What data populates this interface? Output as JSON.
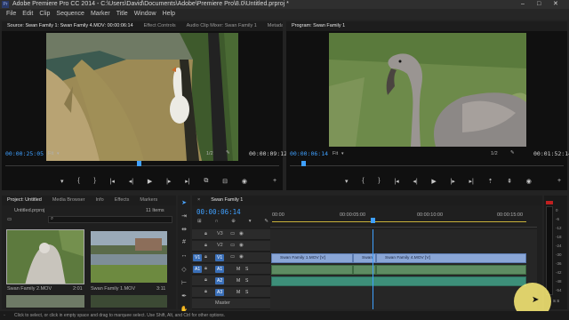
{
  "window": {
    "title": "Adobe Premiere Pro CC 2014 - C:\\Users\\David\\Documents\\Adobe\\Premiere Pro\\8.0\\Untitled.prproj *"
  },
  "menu": [
    "File",
    "Edit",
    "Clip",
    "Sequence",
    "Marker",
    "Title",
    "Window",
    "Help"
  ],
  "source_monitor": {
    "tabs": [
      "Source: Swan Family 1: Swan Family 4.MOV: 00:00:06:14",
      "Effect Controls",
      "Audio Clip Mixer: Swan Family 1",
      "Metada"
    ],
    "timecode_left": "00:00:25:05",
    "fit": "Fit",
    "fraction": "1/2",
    "timecode_right": "00:00:09:12"
  },
  "program_monitor": {
    "tabs": [
      "Program: Swan Family 1"
    ],
    "timecode_left": "00:00:06:14",
    "fit": "Fit",
    "fraction": "1/2",
    "timecode_right": "00:01:52:14"
  },
  "project_panel": {
    "tabs": [
      "Project: Untitled",
      "Media Browser",
      "Info",
      "Effects",
      "Markers"
    ],
    "filename": "Untitled.prproj",
    "item_count": "11 Items",
    "items": [
      {
        "name": "Swan Family 2.MOV",
        "duration": "2:01"
      },
      {
        "name": "Swan Family 1.MOV",
        "duration": "3:11"
      }
    ]
  },
  "timeline": {
    "tab": "Swan Family 1",
    "timecode": "00:00:06:14",
    "ruler": [
      "00:00",
      "00:00:05:00",
      "00:00:10:00",
      "00:00:15:00"
    ],
    "tracks": [
      {
        "id": "V3",
        "type": "video"
      },
      {
        "id": "V2",
        "type": "video"
      },
      {
        "id": "V1",
        "type": "video"
      },
      {
        "id": "A1",
        "type": "audio"
      },
      {
        "id": "A2",
        "type": "audio"
      },
      {
        "id": "A3",
        "type": "audio"
      }
    ],
    "source_patch": [
      "V1",
      "A1"
    ],
    "track_btn_m": "M",
    "track_btn_s": "S",
    "clips": [
      {
        "label": "Swan Family 1.MOV [V]"
      },
      {
        "label": "Swan"
      },
      {
        "label": "Swan Family 4.MOV [V]"
      }
    ],
    "master_label": "Master"
  },
  "meter": {
    "scale": [
      "0",
      "-6",
      "-12",
      "-18",
      "-24",
      "-30",
      "-36",
      "-42",
      "-48",
      "-54"
    ],
    "footer": "S S"
  },
  "status_bar": {
    "text": "Click to select, or click in empty space and drag to marquee select. Use Shift, Alt, and Ctrl for other options."
  },
  "colors": {
    "timecode_blue": "#3fa0ff",
    "video_clip": "#8aa6d6",
    "audio_clip": "#5e8c62",
    "playhead": "#3fa0ff"
  }
}
